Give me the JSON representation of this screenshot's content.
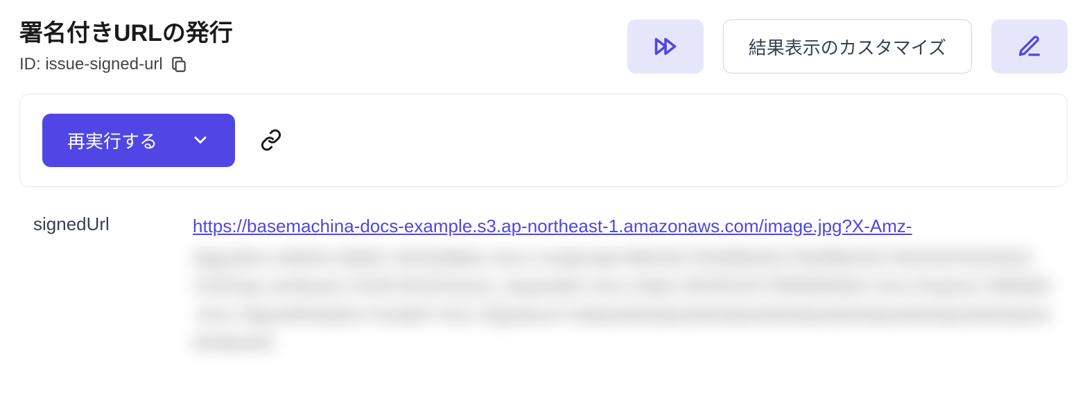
{
  "header": {
    "title": "署名付きURLの発行",
    "id_label": "ID: issue-signed-url"
  },
  "actions": {
    "customize_label": "結果表示のカスタマイズ"
  },
  "panel": {
    "rerun_label": "再実行する"
  },
  "result": {
    "key": "signedUrl",
    "url_visible": "https://basemachina-docs-example.s3.ap-northeast-1.amazonaws.com/image.jpg?X-Amz-",
    "url_hidden": "Algorithm=AWS4-HMAC-SHA256&X-Amz-Credential=REDACTEDREDACTEDREDACTED%2F20240101%2Fap-northeast-1%2Fs3%2Faws4_request&X-Amz-Date=20240101T000000Z&X-Amz-Expires=3600&X-Amz-SignedHeaders=host&X-Amz-Signature=redactedredactedredactedredactedredactedredactedredactedredacted"
  }
}
